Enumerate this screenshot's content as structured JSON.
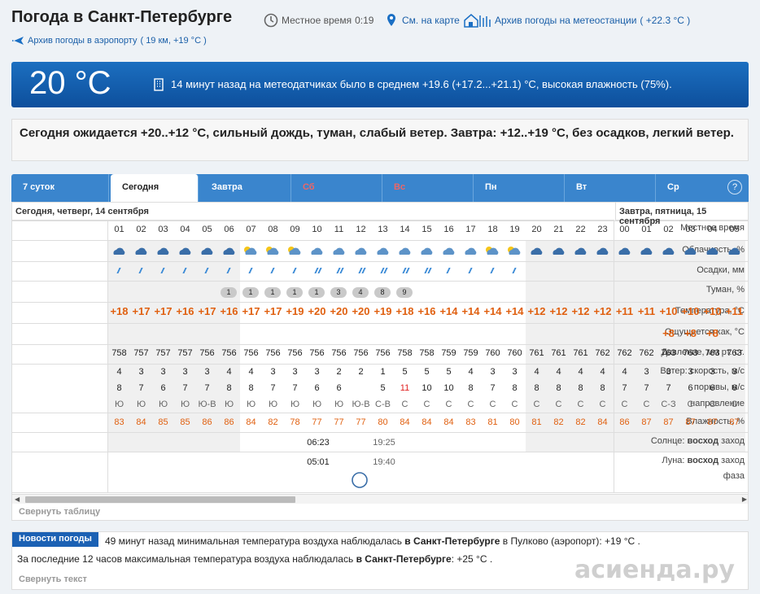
{
  "header": {
    "title": "Погода в Санкт-Петербурге",
    "local_time_label": "Местное время",
    "local_time_value": "0:19",
    "map_link": "См. на карте",
    "station_archive": "Архив погоды на метеостанции",
    "station_temp": "( +22.3 °С )",
    "airport_archive": "Архив погоды в аэропорту",
    "airport_info": "( 19 км, +19 °C )"
  },
  "now": {
    "temp": "20 °C",
    "text": "14 минут назад на метеодатчиках было в среднем +19.6 (+17.2...+21.1) °С, высокая влажность (75%)."
  },
  "forecast_text": "Сегодня ожидается +20..+12 °С, сильный дождь, туман, слабый ветер. Завтра: +12..+19 °С, без осадков, легкий ветер.",
  "tabs": [
    {
      "label": "7 суток"
    },
    {
      "label": "Сегодня"
    },
    {
      "label": "Завтра"
    },
    {
      "label": "Сб"
    },
    {
      "label": "Вс"
    },
    {
      "label": "Пн"
    },
    {
      "label": "Вт"
    },
    {
      "label": "Ср"
    }
  ],
  "help": "?",
  "table": {
    "day1": "Сегодня, четверг, 14 сентября",
    "day2": "Завтра, пятница, 15 сентября",
    "labels": {
      "time": "Местное время",
      "cloud": "Облачность, %",
      "precip": "Осадки, мм",
      "fog": "Туман, %",
      "temp": "Температура, °С",
      "feels": "Ощущается как, °С",
      "pressure": "Давление, мм рт. ст.",
      "wind_speed": "Ветер: скорость, м/с",
      "gusts": "порывы, м/с",
      "direction": "направление",
      "humidity": "Влажность, %",
      "sun_prefix": "Солнце:",
      "sun_rise": "восход",
      "sun_set": "заход",
      "moon_prefix": "Луна:",
      "moon_rise": "восход",
      "moon_set": "заход",
      "moon_phase": "фаза"
    },
    "hours": [
      "01",
      "02",
      "03",
      "04",
      "05",
      "06",
      "07",
      "08",
      "09",
      "10",
      "11",
      "12",
      "13",
      "14",
      "15",
      "16",
      "17",
      "18",
      "19",
      "20",
      "21",
      "22",
      "23",
      "00",
      "01",
      "02",
      "03",
      "04",
      "05"
    ],
    "fog": [
      "",
      "",
      "",
      "",
      "",
      "1",
      "1",
      "1",
      "1",
      "1",
      "3",
      "4",
      "8",
      "9",
      "",
      "",
      "",
      "",
      "",
      "",
      "",
      "",
      "",
      "",
      "",
      "",
      "",
      "",
      ""
    ],
    "temp": [
      "+18",
      "+17",
      "+17",
      "+16",
      "+17",
      "+16",
      "+17",
      "+17",
      "+19",
      "+20",
      "+20",
      "+20",
      "+19",
      "+18",
      "+16",
      "+14",
      "+14",
      "+14",
      "+14",
      "+12",
      "+12",
      "+12",
      "+12",
      "+11",
      "+11",
      "+10",
      "+10",
      "+10",
      "+11"
    ],
    "feels": [
      "",
      "",
      "",
      "",
      "",
      "",
      "",
      "",
      "",
      "",
      "",
      "",
      "",
      "",
      "",
      "",
      "",
      "",
      "",
      "",
      "",
      "",
      "",
      "",
      "",
      "+8",
      "+8",
      "+8",
      ""
    ],
    "pressure": [
      "758",
      "757",
      "757",
      "757",
      "756",
      "756",
      "756",
      "756",
      "756",
      "756",
      "756",
      "756",
      "756",
      "758",
      "758",
      "759",
      "759",
      "760",
      "760",
      "761",
      "761",
      "761",
      "762",
      "762",
      "762",
      "763",
      "763",
      "763",
      "763"
    ],
    "wind": [
      "4",
      "3",
      "3",
      "3",
      "3",
      "4",
      "4",
      "3",
      "3",
      "3",
      "2",
      "2",
      "1",
      "5",
      "5",
      "5",
      "4",
      "3",
      "3",
      "4",
      "4",
      "4",
      "4",
      "4",
      "3",
      "3",
      "3",
      "3",
      "3"
    ],
    "gusts": [
      "8",
      "7",
      "6",
      "7",
      "7",
      "8",
      "8",
      "7",
      "7",
      "6",
      "6",
      "",
      "5",
      "11",
      "10",
      "10",
      "8",
      "7",
      "8",
      "8",
      "8",
      "8",
      "8",
      "7",
      "7",
      "7",
      "6",
      "6",
      "6"
    ],
    "direction": [
      "Ю",
      "Ю",
      "Ю",
      "Ю",
      "Ю-В",
      "Ю",
      "Ю",
      "Ю",
      "Ю",
      "Ю",
      "Ю",
      "Ю-В",
      "С-В",
      "С",
      "С",
      "С",
      "С",
      "С",
      "С",
      "С",
      "С",
      "С",
      "С",
      "С",
      "С",
      "С-З",
      "С",
      "С",
      "С"
    ],
    "humidity": [
      "83",
      "84",
      "85",
      "85",
      "86",
      "86",
      "84",
      "82",
      "78",
      "77",
      "77",
      "77",
      "80",
      "84",
      "84",
      "84",
      "83",
      "81",
      "80",
      "81",
      "82",
      "82",
      "84",
      "86",
      "87",
      "87",
      "87",
      "87",
      "87"
    ],
    "sun_rise": "06:23",
    "sun_set": "19:25",
    "moon_rise": "05:01",
    "moon_set": "19:40",
    "collapse": "Свернуть таблицу"
  },
  "news": {
    "badge": "Новости погоды",
    "line1_a": "49 минут назад минимальная температура воздуха наблюдалась",
    "line1_b": "в Санкт-Петербурге",
    "line1_c": "в Пулково (аэропорт): +19 °С .",
    "line2_a": "За последние 12 часов максимальная температура воздуха наблюдалась",
    "line2_b": "в Санкт-Петербурге",
    "line2_c": ": +25 °С .",
    "collapse": "Свернуть текст"
  },
  "watermark": "асиенда.ру"
}
